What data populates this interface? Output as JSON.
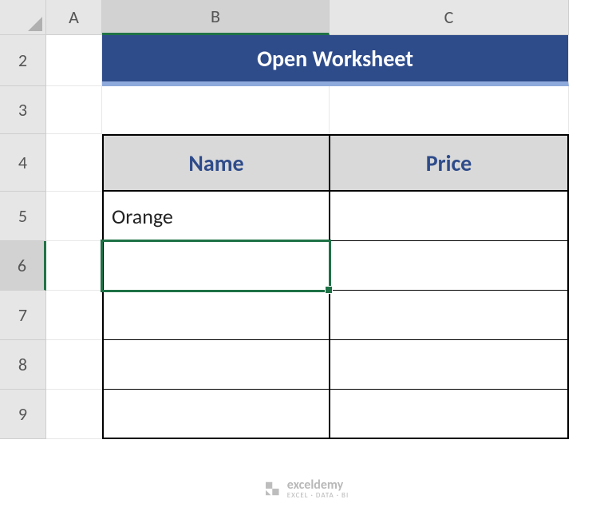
{
  "columns": {
    "A": "A",
    "B": "B",
    "C": "C"
  },
  "rows": {
    "r2": "2",
    "r3": "3",
    "r4": "4",
    "r5": "5",
    "r6": "6",
    "r7": "7",
    "r8": "8",
    "r9": "9"
  },
  "title": "Open Worksheet",
  "table": {
    "headers": {
      "name": "Name",
      "price": "Price"
    },
    "rows": [
      {
        "name": "Orange",
        "price": ""
      },
      {
        "name": "",
        "price": ""
      },
      {
        "name": "",
        "price": ""
      },
      {
        "name": "",
        "price": ""
      },
      {
        "name": "",
        "price": ""
      }
    ]
  },
  "active_cell": "B6",
  "watermark": {
    "brand": "exceldemy",
    "tagline": "EXCEL · DATA · BI"
  },
  "colors": {
    "selection_border": "#1e7145",
    "title_bg": "#2e4b8a",
    "title_underline": "#8ea9db",
    "table_header_bg": "#d9d9d9",
    "table_header_text": "#2e4b8a"
  }
}
